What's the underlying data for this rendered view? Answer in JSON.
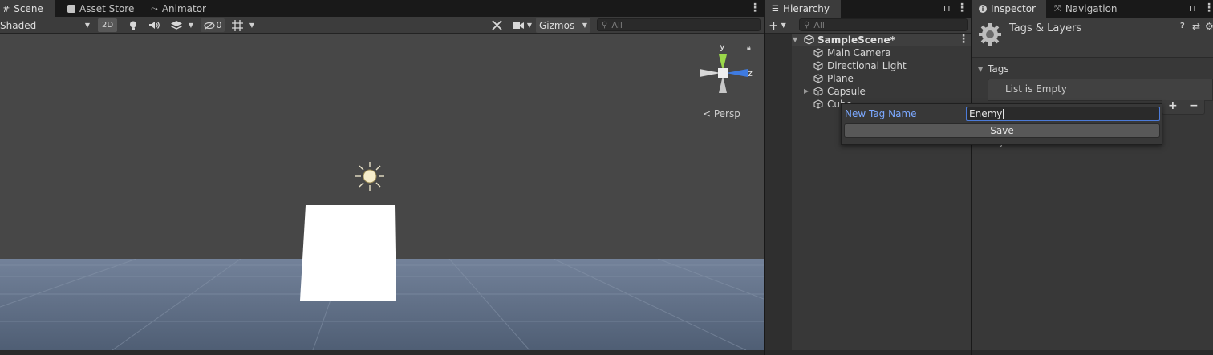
{
  "scene_panel": {
    "tabs": [
      {
        "label": "Scene",
        "icon": "grid-icon"
      },
      {
        "label": "Asset Store",
        "icon": "shopping-bag-icon"
      },
      {
        "label": "Animator",
        "icon": "animator-icon"
      }
    ],
    "toolbar": {
      "shading_mode": "Shaded",
      "mode_2d": "2D",
      "hidden_count": "0",
      "gizmos_label": "Gizmos",
      "search_placeholder": "All"
    },
    "gizmo": {
      "axis_y": "y",
      "axis_z": "z",
      "projection": "< Persp"
    }
  },
  "hierarchy": {
    "tab_label": "Hierarchy",
    "search_placeholder": "All",
    "scene_name": "SampleScene*",
    "items": [
      {
        "label": "Main Camera"
      },
      {
        "label": "Directional Light"
      },
      {
        "label": "Plane"
      },
      {
        "label": "Capsule"
      },
      {
        "label": "Cube"
      }
    ]
  },
  "inspector": {
    "tabs": [
      {
        "label": "Inspector",
        "icon": "info-icon"
      },
      {
        "label": "Navigation",
        "icon": "navigation-icon"
      }
    ],
    "title": "Tags & Layers",
    "tags_section": "Tags",
    "list_empty": "List is Empty",
    "layers_section": "Layers"
  },
  "popup": {
    "label": "New Tag Name",
    "value": "Enemy",
    "save_label": "Save"
  },
  "colors": {
    "accent_blue": "#4c7bd9",
    "label_blue": "#7ba8ff",
    "panel_bg": "#383838",
    "toolbar_bg": "#3c3c3c"
  }
}
